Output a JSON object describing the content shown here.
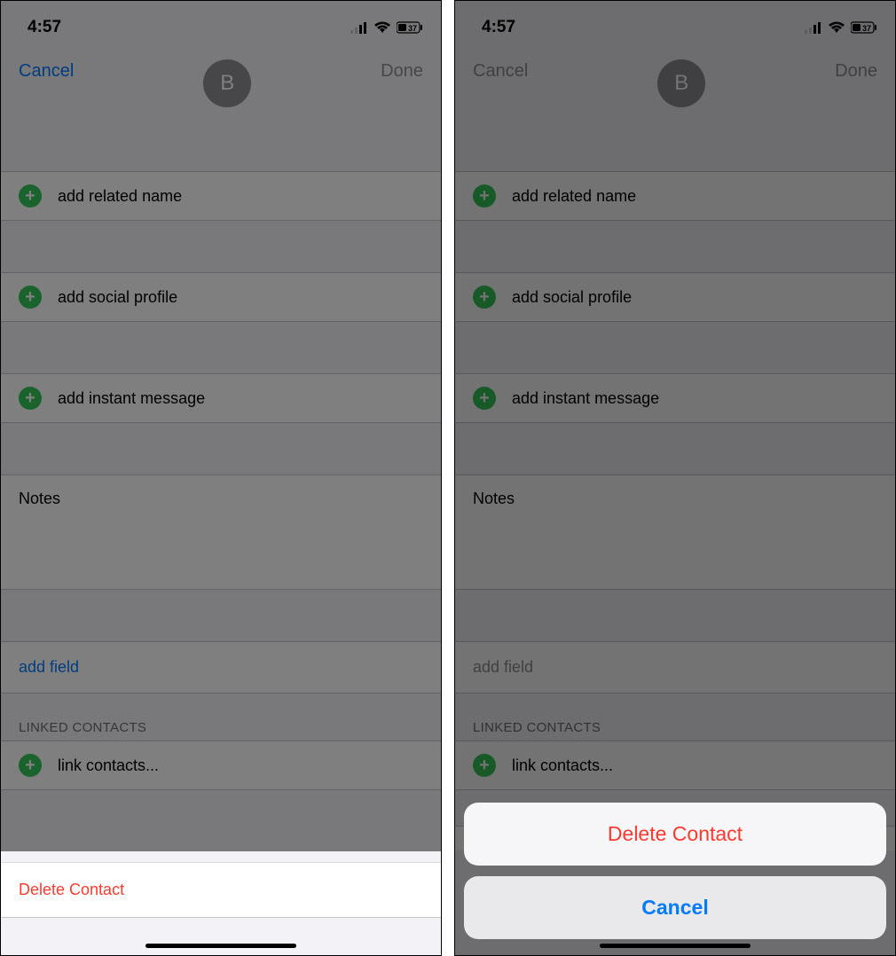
{
  "status": {
    "time": "4:57",
    "battery": "37"
  },
  "header": {
    "cancel": "Cancel",
    "done": "Done",
    "avatar_initial": "B"
  },
  "rows": {
    "related_name": "add related name",
    "social_profile": "add social profile",
    "instant_message": "add instant message",
    "notes": "Notes",
    "add_field": "add field"
  },
  "linked": {
    "header": "LINKED CONTACTS",
    "link_contacts": "link contacts..."
  },
  "delete_row": "Delete Contact",
  "sheet": {
    "delete": "Delete Contact",
    "cancel": "Cancel"
  }
}
